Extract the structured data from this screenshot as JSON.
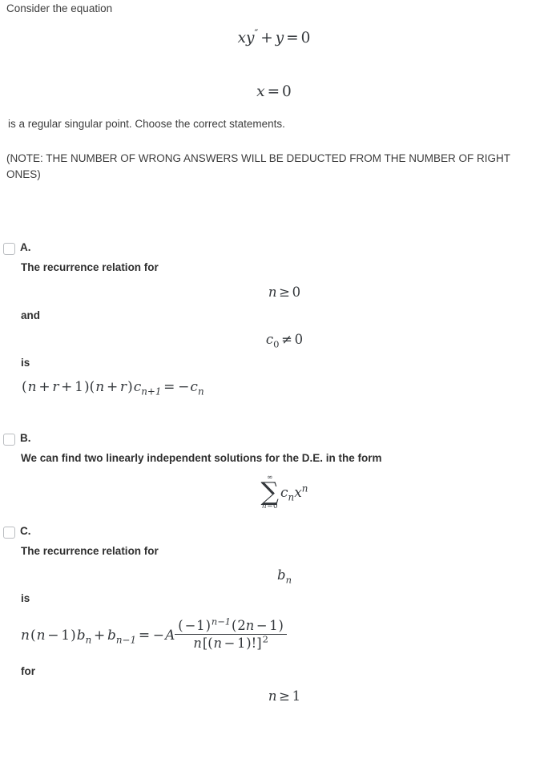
{
  "stem": {
    "intro": "Consider the equation",
    "equation_main": "xy'' + y = 0",
    "equation_point": "x = 0",
    "after": "is a regular singular point. Choose the correct statements.",
    "note": "(NOTE: THE NUMBER OF WRONG ANSWERS WILL BE DEDUCTED FROM THE NUMBER OF RIGHT ONES)"
  },
  "options": [
    {
      "letter": "A.",
      "checked": false,
      "text_1": "The recurrence relation for",
      "math_1": "n ≥ 0",
      "text_2": "and",
      "math_2": "c₀ ≠ 0",
      "text_3": "is",
      "math_3": "(n + r + 1)(n + r)cₙ₊₁ = −cₙ"
    },
    {
      "letter": "B.",
      "checked": false,
      "text_1": "We can find two linearly independent solutions for the D.E. in the form",
      "math_1": "∑ from n=0 to ∞ of cₙxⁿ",
      "sum_upper": "∞",
      "sum_lower": "n=0"
    },
    {
      "letter": "C.",
      "checked": false,
      "text_1": "The recurrence relation for",
      "math_1": "bₙ",
      "text_2": "is",
      "math_2": "n(n − 1)bₙ + bₙ₋₁ = −A (−1)ⁿ⁻¹(2n − 1) / n[(n − 1)!]²",
      "text_3": "for",
      "math_3": "n ≥ 1"
    }
  ],
  "colors": {
    "text": "#3d3d3d",
    "option_text": "#2f2f2f",
    "math": "#33373b",
    "checkbox_border": "#b9bcc0",
    "background": "#ffffff"
  }
}
